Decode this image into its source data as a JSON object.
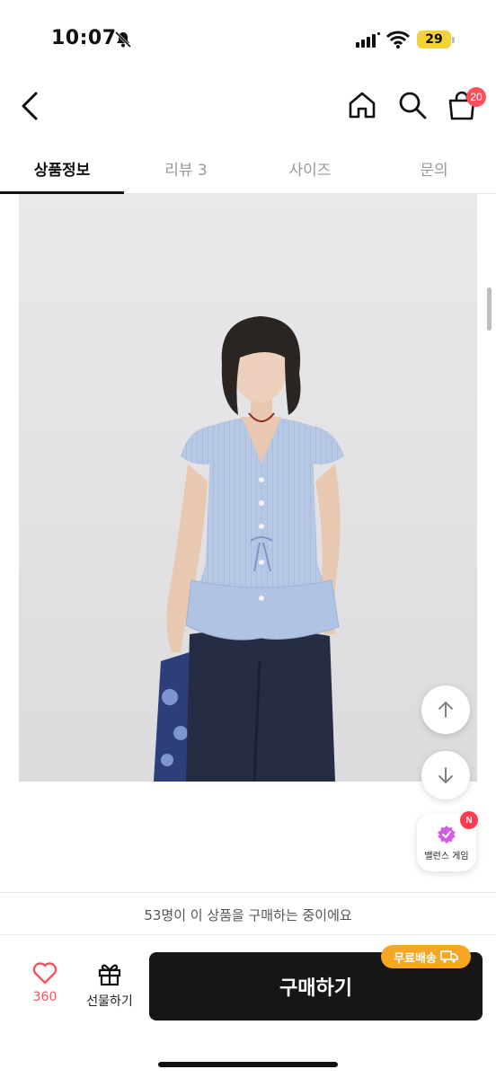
{
  "status_bar": {
    "time": "10:07",
    "battery": "29"
  },
  "header": {
    "cart_count": "20"
  },
  "tabs": [
    {
      "label": "상품정보",
      "active": true
    },
    {
      "label": "리뷰 3",
      "active": false
    },
    {
      "label": "사이즈",
      "active": false
    },
    {
      "label": "문의",
      "active": false
    }
  ],
  "product": {
    "image_alt": "product model photo",
    "colors": {
      "top": "#b4c6e3",
      "pants": "#252c44",
      "background": "#e5e4e6"
    }
  },
  "floating": {
    "game_label": "밸런스 게임",
    "game_badge": "N"
  },
  "bottom": {
    "buyers_notice": "53명이 이 상품을 구매하는 중이에요",
    "like_count": "360",
    "gift_label": "선물하기",
    "buy_label": "구매하기",
    "shipping_badge": "무료배송"
  },
  "colors": {
    "accent": "#ff4f5e",
    "buy_button": "#161616",
    "shipping": "#f5a623"
  }
}
